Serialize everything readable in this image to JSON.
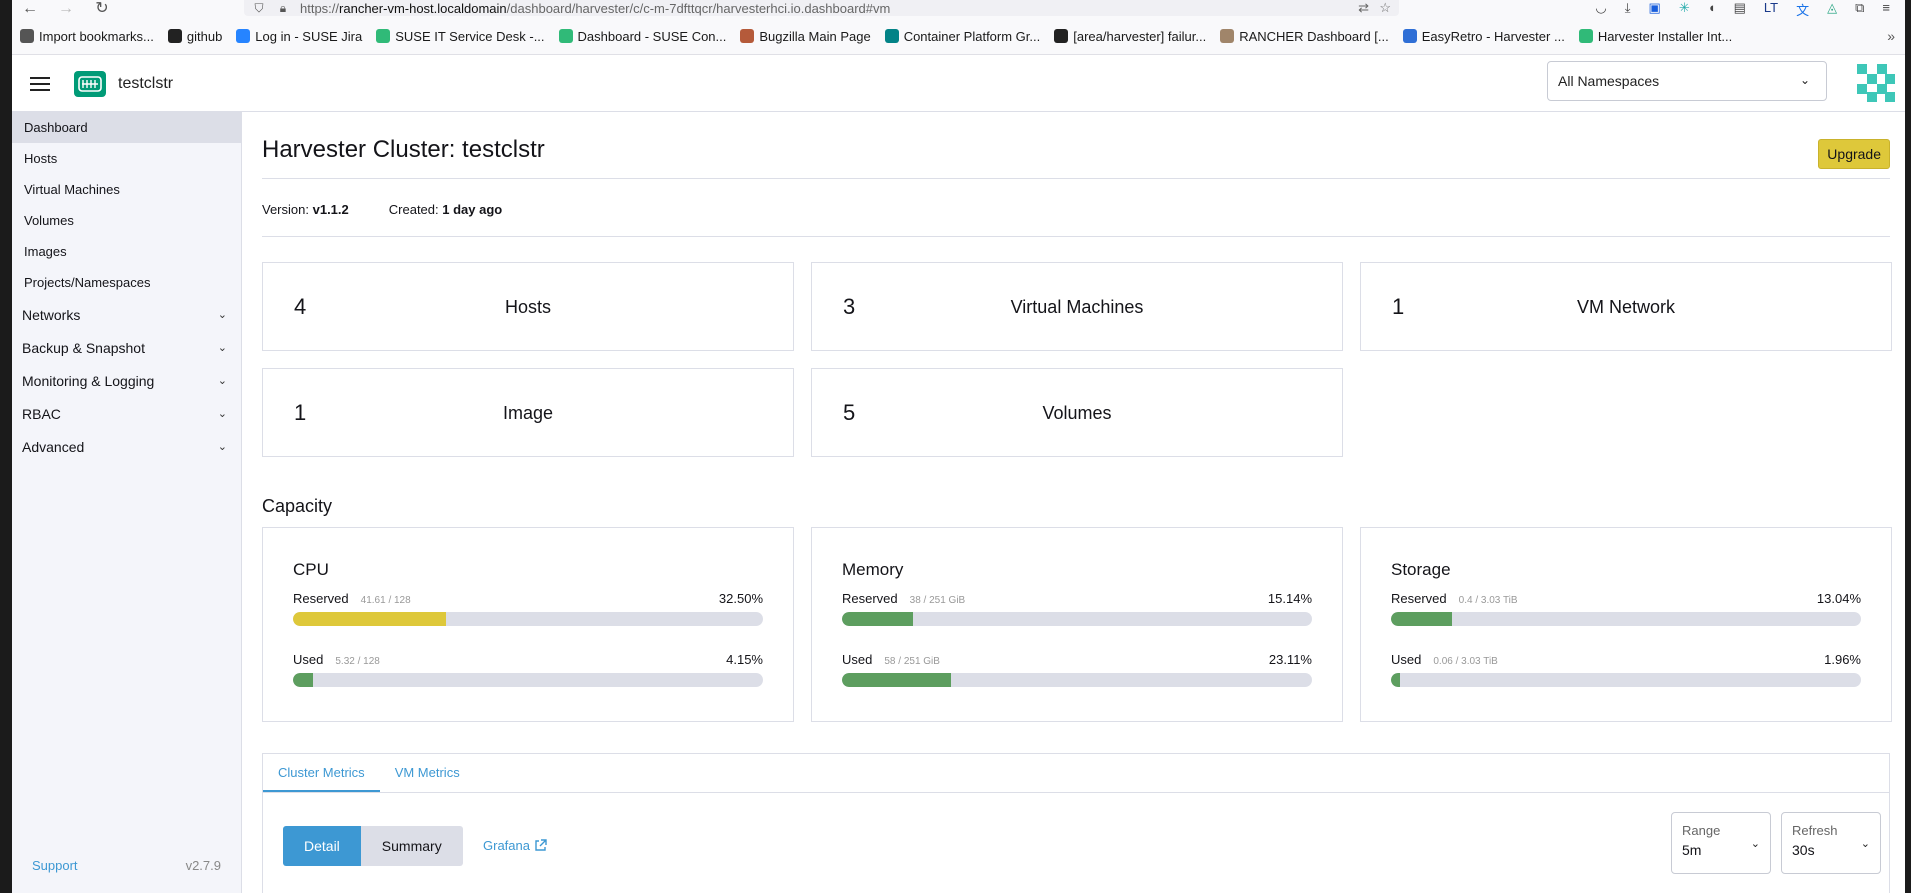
{
  "browser": {
    "url_scheme": "https://",
    "url_host": "rancher-vm-host.localdomain",
    "url_path": "/dashboard/harvester/c/c-m-7dfttqcr/harvesterhci.io.dashboard#vm",
    "bookmarks": [
      {
        "label": "Import bookmarks...",
        "icon": "import-icon",
        "color": "#555555"
      },
      {
        "label": "github",
        "icon": "github-icon",
        "color": "#222222"
      },
      {
        "label": "Log in - SUSE Jira",
        "icon": "jira-icon",
        "color": "#2684ff"
      },
      {
        "label": "SUSE IT Service Desk -...",
        "icon": "suse-chameleon-icon",
        "color": "#30ba78"
      },
      {
        "label": "Dashboard - SUSE Con...",
        "icon": "confluence-icon",
        "color": "#30ba78"
      },
      {
        "label": "Bugzilla Main Page",
        "icon": "bugzilla-icon",
        "color": "#b55a3a"
      },
      {
        "label": "Container Platform Gr...",
        "icon": "sharepoint-icon",
        "color": "#038387"
      },
      {
        "label": "[area/harvester] failur...",
        "icon": "github-icon",
        "color": "#222222"
      },
      {
        "label": "RANCHER Dashboard [...",
        "icon": "rancher-icon",
        "color": "#a0856a"
      },
      {
        "label": "EasyRetro - Harvester ...",
        "icon": "easyretro-icon",
        "color": "#2f6fd6"
      },
      {
        "label": "Harvester Installer Int...",
        "icon": "confluence-icon",
        "color": "#30ba78"
      }
    ]
  },
  "header": {
    "cluster_name": "testclstr",
    "namespace_filter": "All Namespaces"
  },
  "sidebar": {
    "items": [
      {
        "label": "Dashboard",
        "active": true
      },
      {
        "label": "Hosts"
      },
      {
        "label": "Virtual Machines"
      },
      {
        "label": "Volumes"
      },
      {
        "label": "Images"
      },
      {
        "label": "Projects/Namespaces"
      }
    ],
    "groups": [
      "Networks",
      "Backup & Snapshot",
      "Monitoring & Logging",
      "RBAC",
      "Advanced"
    ],
    "support_label": "Support",
    "version": "v2.7.9"
  },
  "main": {
    "title": "Harvester Cluster: testclstr",
    "upgrade_label": "Upgrade",
    "version_label": "Version:",
    "version_value": "v1.1.2",
    "created_label": "Created:",
    "created_value": "1 day ago",
    "counts": [
      {
        "count": "4",
        "label": "Hosts"
      },
      {
        "count": "3",
        "label": "Virtual Machines"
      },
      {
        "count": "1",
        "label": "VM Network"
      },
      {
        "count": "1",
        "label": "Image"
      },
      {
        "count": "5",
        "label": "Volumes"
      }
    ],
    "capacity_title": "Capacity",
    "capacity": [
      {
        "title": "CPU",
        "reserved": {
          "label": "Reserved",
          "detail": "41.61 / 128",
          "percent": "32.50%",
          "fraction": 0.325,
          "color": "#dec83a"
        },
        "used": {
          "label": "Used",
          "detail": "5.32 / 128",
          "percent": "4.15%",
          "fraction": 0.0415,
          "color": "#5d9e5f"
        }
      },
      {
        "title": "Memory",
        "reserved": {
          "label": "Reserved",
          "detail": "38 / 251 GiB",
          "percent": "15.14%",
          "fraction": 0.1514,
          "color": "#5d9e5f"
        },
        "used": {
          "label": "Used",
          "detail": "58 / 251 GiB",
          "percent": "23.11%",
          "fraction": 0.2311,
          "color": "#5d9e5f"
        }
      },
      {
        "title": "Storage",
        "reserved": {
          "label": "Reserved",
          "detail": "0.4 / 3.03 TiB",
          "percent": "13.04%",
          "fraction": 0.1304,
          "color": "#5d9e5f"
        },
        "used": {
          "label": "Used",
          "detail": "0.06 / 3.03 TiB",
          "percent": "1.96%",
          "fraction": 0.0196,
          "color": "#5d9e5f"
        }
      }
    ],
    "metrics": {
      "tabs": [
        "Cluster Metrics",
        "VM Metrics"
      ],
      "detail_label": "Detail",
      "summary_label": "Summary",
      "grafana_label": "Grafana",
      "range_label": "Range",
      "range_value": "5m",
      "refresh_label": "Refresh",
      "refresh_value": "30s"
    }
  }
}
